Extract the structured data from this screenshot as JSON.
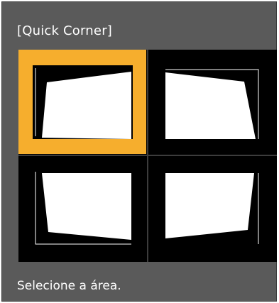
{
  "dialog": {
    "title": "[Quick Corner]",
    "instruction": "Selecione a área."
  },
  "areas": [
    {
      "position": "top-left",
      "selected": true,
      "icon": "keystone-top-left-icon"
    },
    {
      "position": "top-right",
      "selected": false,
      "icon": "keystone-top-right-icon"
    },
    {
      "position": "bottom-left",
      "selected": false,
      "icon": "keystone-bottom-left-icon"
    },
    {
      "position": "bottom-right",
      "selected": false,
      "icon": "keystone-bottom-right-icon"
    }
  ],
  "colors": {
    "panel": "#5a5a5a",
    "grid": "#000000",
    "selection": "#f6ae2d",
    "text": "#ffffff"
  }
}
